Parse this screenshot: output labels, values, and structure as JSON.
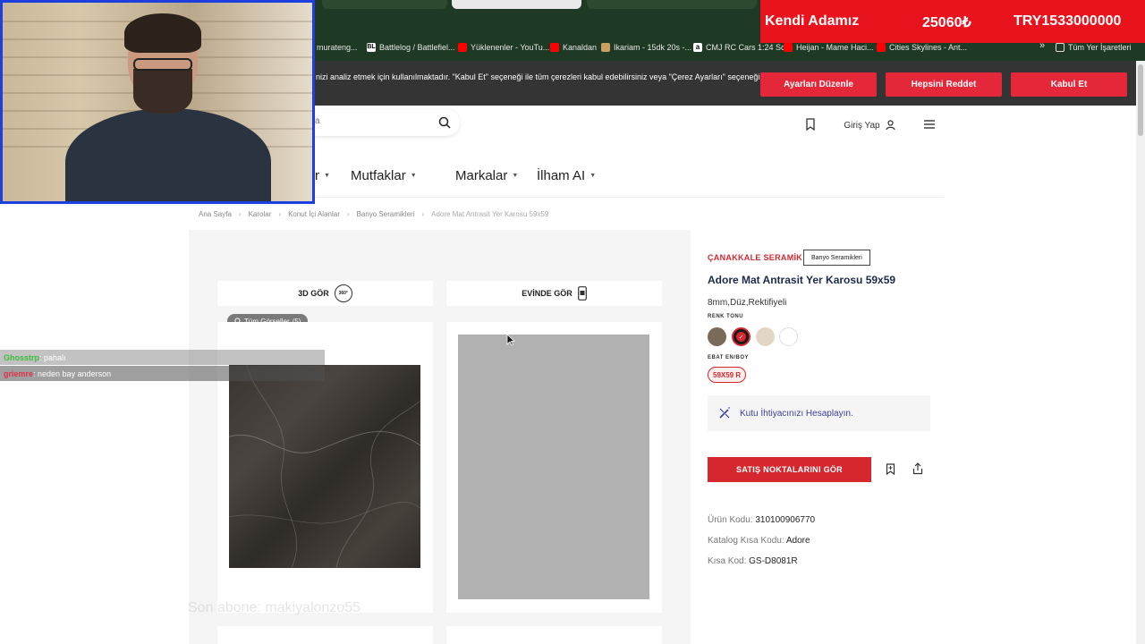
{
  "browser": {
    "bookmarks": [
      {
        "label": "murateng...",
        "icon": "bookmark-icon"
      },
      {
        "label": "Battlelog / Battlefiel...",
        "icon": "battlelog-icon"
      },
      {
        "label": "Yüklenenler - YouTu...",
        "icon": "youtube-icon"
      },
      {
        "label": "Kanaldan",
        "icon": "youtube-icon"
      },
      {
        "label": "Ikariam - 15dk 20s -...",
        "icon": "ikariam-icon"
      },
      {
        "label": "CMJ RC Cars 1:24 Sc...",
        "icon": "amazon-icon"
      },
      {
        "label": "Heijan - Mame Haci...",
        "icon": "youtube-icon"
      },
      {
        "label": "Cities Skylines - Ant...",
        "icon": "youtube-icon"
      }
    ],
    "more": "»",
    "all_bookmarks": "Tüm Yer İşaretleri"
  },
  "cookie": {
    "text": "nizi analiz etmek için kullanılmaktadır. \"Kabul Et\" seçeneği ile tüm çerezleri kabul edebilirsiniz veya \"Çerez Ayarları\" seçeneği",
    "settings_btn": "Ayarları Düzenle",
    "reject_btn": "Hepsini Reddet",
    "accept_btn": "Kabul Et"
  },
  "header": {
    "search_placeholder": "a",
    "login_label": "Giriş Yap"
  },
  "nav": {
    "items": [
      "r",
      "Mutfaklar",
      "Markalar",
      "İlham AI"
    ]
  },
  "breadcrumb": [
    "Ana Sayfa",
    "Karolar",
    "Konut İçi Alanlar",
    "Banyo Seramikleri",
    "Adore Mat Antrasit Yer Karosu 59x59"
  ],
  "gallery": {
    "view3d_label": "3D GÖR",
    "view3d_badge": "360°",
    "athome_label": "EVİNDE GÖR",
    "all_images": "Tüm Görseller",
    "all_images_count": "(5)"
  },
  "product": {
    "brand": "ÇANAKKALE SERAMİK",
    "category_badge": "Banyo Seramikleri",
    "title": "Adore Mat Antrasit Yer Karosu 59x59",
    "spec": "8mm,Düz,Rektifiyeli",
    "color_label": "RENK TONU",
    "colors": [
      "#7a6a5a",
      "#1a1a1a",
      "#e2d6c6",
      "#ffffff"
    ],
    "size_label": "EBAT EN/BOY",
    "size_value": "59X59 R",
    "calc_label": "Kutu İhtiyacınızı Hesaplayın.",
    "sales_btn": "SATIŞ NOKTALARINI GÖR",
    "code_label": "Ürün Kodu:",
    "code_value": "310100906770",
    "catalog_label": "Katalog Kısa Kodu:",
    "catalog_value": "Adore",
    "short_label": "Kısa Kod:",
    "short_value": "GS-D8081R"
  },
  "overlay": {
    "promo": [
      "Kendi Adamız",
      "25060₺",
      "TRY1533000000"
    ],
    "chat": [
      {
        "user": "Ghosstrp",
        "message": ": pahalı",
        "color": "#3dbd3d"
      },
      {
        "user": "griemre",
        "message": ": neden bay anderson",
        "color": "#e0304a"
      }
    ],
    "watermark": "Son abone: makiyalonzo55"
  },
  "colors": {
    "accent": "#d6272f",
    "cookie_button": "#e5273a",
    "cookie_bar": "#343434",
    "browser": "#1f3a24",
    "webcam_border": "#1d3fe0",
    "promo": "#e8131c"
  }
}
